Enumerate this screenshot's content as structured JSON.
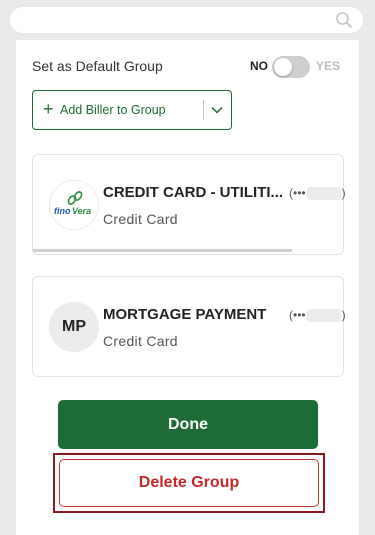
{
  "search": {
    "placeholder": ""
  },
  "default_group": {
    "label": "Set as Default Group",
    "off_label": "NO",
    "on_label": "YES",
    "enabled": false
  },
  "add_biller": {
    "label": "Add Biller to Group",
    "plus": "+"
  },
  "billers": [
    {
      "name": "CREDIT CARD - UTILITI...",
      "account_prefix": "(•••",
      "account_suffix": ")",
      "type": "Credit Card",
      "logo": "finoVera"
    },
    {
      "name": "MORTGAGE PAYMENT",
      "account_prefix": "(•••",
      "account_suffix": ")",
      "type": "Credit Card",
      "initials": "MP"
    }
  ],
  "actions": {
    "done_label": "Done",
    "delete_label": "Delete Group"
  },
  "colors": {
    "primary_green": "#1d6b35",
    "danger_red": "#c62828",
    "highlight": "#8b1a1a"
  }
}
